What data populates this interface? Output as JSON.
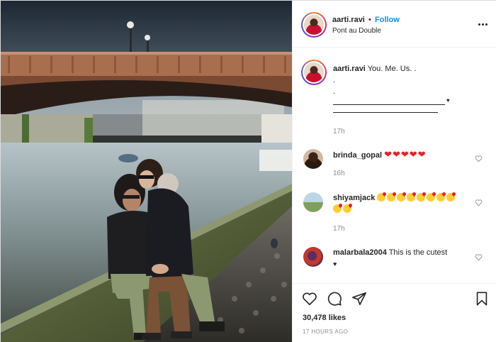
{
  "post": {
    "photo_alt": "",
    "header": {
      "username": "aarti.ravi",
      "separator": "•",
      "follow_label": "Follow",
      "location": "Pont au Double"
    },
    "caption": {
      "username": "aarti.ravi",
      "text": "You. Me. Us. .",
      "dot1": ".",
      "dot2": ".",
      "time": "17h"
    },
    "comments": [
      {
        "username": "brinda_gopal",
        "text": "❤❤❤❤❤",
        "time": "16h"
      },
      {
        "username": "shiyamjack",
        "emoji_count": 10,
        "time": "17h"
      },
      {
        "username": "malarbala2004",
        "text": "This is the cutest",
        "text2": "♥",
        "time": ""
      }
    ],
    "likes": "30,478 likes",
    "timestamp": "17 HOURS AGO",
    "colors": {
      "follow": "#0095f6",
      "heart": "#ed1c24",
      "muted": "#8e8e8e",
      "text": "#262626"
    },
    "icons": [
      "more-options-icon",
      "heart-icon",
      "comment-icon",
      "share-icon",
      "bookmark-icon"
    ]
  }
}
